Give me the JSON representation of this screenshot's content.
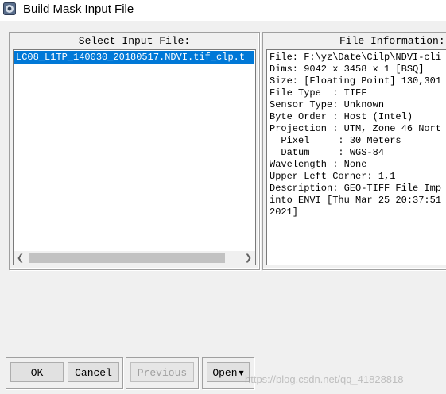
{
  "window": {
    "title": "Build Mask Input File"
  },
  "select_panel": {
    "header": "Select Input File:",
    "selected_file": "LC08_L1TP_140030_20180517.NDVI.tif_clp.t",
    "scroll_left_icon": "chevron-left-icon",
    "scroll_right_icon": "chevron-right-icon"
  },
  "info_panel": {
    "header": "File Information:",
    "lines": [
      "File: F:\\yz\\Date\\Cilp\\NDVI-cli",
      "Dims: 9042 x 3458 x 1 [BSQ]",
      "Size: [Floating Point] 130,301",
      "File Type  : TIFF",
      "Sensor Type: Unknown",
      "Byte Order : Host (Intel)",
      "Projection : UTM, Zone 46 Nort",
      "  Pixel     : 30 Meters",
      "  Datum     : WGS-84",
      "Wavelength : None",
      "Upper Left Corner: 1,1",
      "Description: GEO-TIFF File Imp",
      "into ENVI [Thu Mar 25 20:37:51",
      "2021]"
    ]
  },
  "buttons": {
    "ok": "OK",
    "cancel": "Cancel",
    "previous": "Previous",
    "open": "Open"
  },
  "watermark": "https://blog.csdn.net/qq_41828818",
  "colors": {
    "selection": "#0078d7",
    "dialog_bg": "#f0f0f0",
    "disabled_text": "#a0a0a0"
  }
}
